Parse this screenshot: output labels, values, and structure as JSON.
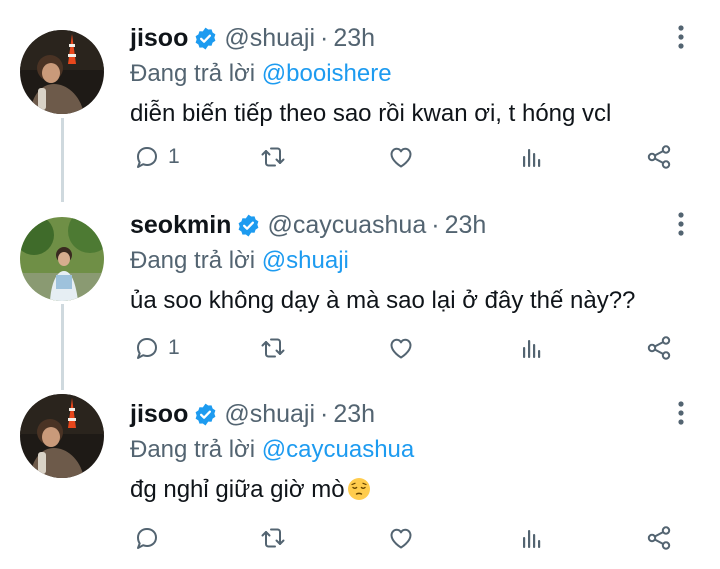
{
  "colors": {
    "accent": "#1d9bf0",
    "secondary_text": "#536471",
    "thread_line": "#cfd9de"
  },
  "tweets": [
    {
      "name": "jisoo",
      "handle": "@shuaji",
      "time": "23h",
      "replying_prefix": "Đang trả lời ",
      "replying_to": "@booishere",
      "text": "diễn biến tiếp theo sao rồi kwan ơi, t hóng vcl",
      "reply_count": "1",
      "avatar": "tokyo-tower-selfie"
    },
    {
      "name": "seokmin",
      "handle": "@caycuashua",
      "time": "23h",
      "replying_prefix": "Đang trả lời ",
      "replying_to": "@shuaji",
      "text": "ủa soo không dạy à mà sao lại ở đây thế này??",
      "reply_count": "1",
      "avatar": "park-photo"
    },
    {
      "name": "jisoo",
      "handle": "@shuaji",
      "time": "23h",
      "replying_prefix": "Đang trả lời ",
      "replying_to": "@caycuashua",
      "text": "đg nghỉ giữa giờ mò",
      "text_emoji": "pensive-face",
      "reply_count": "",
      "avatar": "tokyo-tower-selfie"
    }
  ],
  "icons": {
    "reply": "comment-icon",
    "retweet": "retweet-icon",
    "like": "heart-icon",
    "views": "analytics-icon",
    "share": "share-icon",
    "more": "more-vertical-icon",
    "verified": "verified-badge-icon"
  }
}
